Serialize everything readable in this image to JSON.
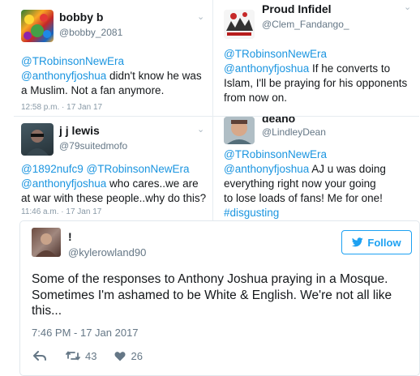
{
  "tweets": [
    {
      "name": "bobby b",
      "handle": "@bobby_2081",
      "line1": "@TRobinsonNewEra",
      "line2_mention": "@anthonyfjoshua",
      "line2_text": " didn't know he was",
      "line3": "a Muslim. Not a fan  anymore.",
      "time": "12:58 p.m. · 17 Jan 17"
    },
    {
      "name": "Proud Infidel",
      "handle": "@Clem_Fandango_",
      "line1": "@TRobinsonNewEra",
      "line2_mention": "@anthonyfjoshua",
      "line2_text": " If he converts to",
      "line3": "Islam, I'll be praying for his opponents",
      "line4": "from now on."
    },
    {
      "name": "j j lewis",
      "handle": "@79suitedmofo",
      "line1_a": "@1892nufc9",
      "line1_b": " @TRobinsonNewEra",
      "line2_mention": "@anthonyfjoshua",
      "line2_text": " who cares..we are",
      "line3": "at war with these people..why do this?",
      "time": "11:46 a.m. · 17 Jan 17"
    },
    {
      "name": "deano",
      "handle": "@LindleyDean",
      "line1": "@TRobinsonNewEra",
      "line2_mention": "@anthonyfjoshua",
      "line2_text": " AJ u was doing",
      "line3": "everything right now your going",
      "line4": "to lose loads of fans! Me for one!",
      "line5": "#disgusting"
    }
  ],
  "main": {
    "name": "!",
    "handle": "@kylerowland90",
    "follow_label": "Follow",
    "text": "Some of the responses to Anthony Joshua praying in a Mosque. Sometimes I'm ashamed to be White & English. We're not all like this...",
    "time": "7:46 PM - 17 Jan 2017",
    "retweets": "43",
    "likes": "26"
  },
  "colors": {
    "link": "#1b95e0",
    "twitter_blue": "#1da1f2",
    "muted": "#657786"
  }
}
